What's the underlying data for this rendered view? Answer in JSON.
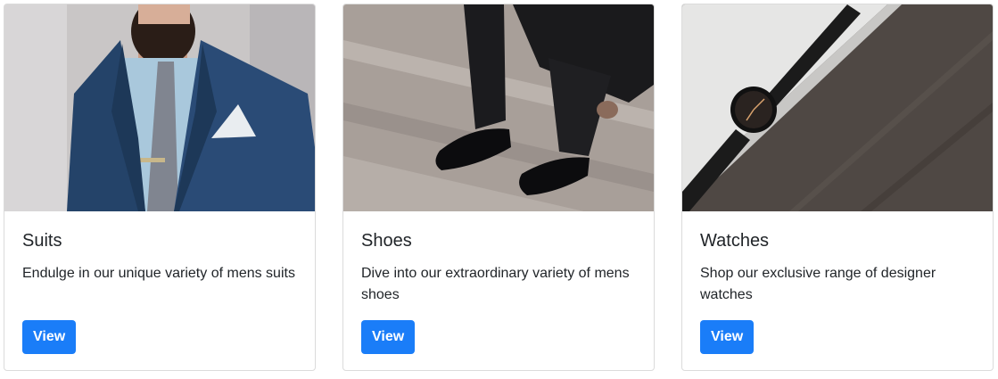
{
  "cards": [
    {
      "title": "Suits",
      "text": "Endulge in our unique variety of mens suits",
      "button": "View"
    },
    {
      "title": "Shoes",
      "text": "Dive into our extraordinary variety of mens shoes",
      "button": "View"
    },
    {
      "title": "Watches",
      "text": "Shop our exclusive range of designer watches",
      "button": "View"
    }
  ],
  "colors": {
    "button": "#1a7df8",
    "border": "#dcdcdc"
  }
}
